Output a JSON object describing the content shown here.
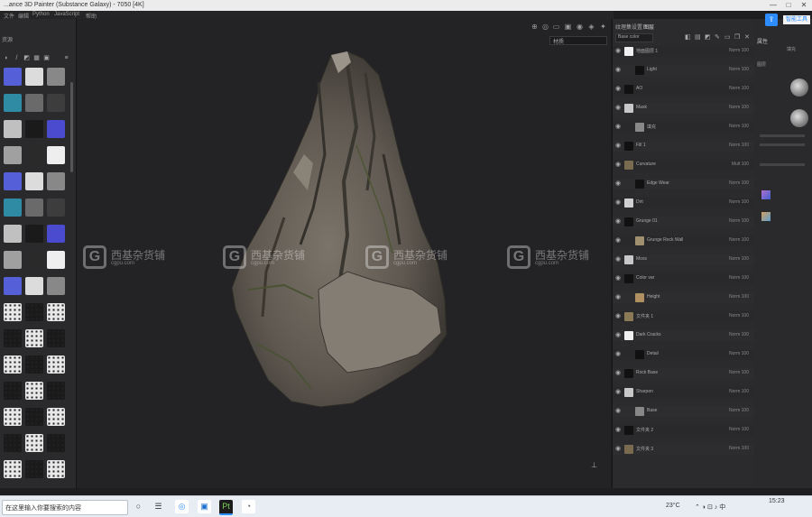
{
  "window": {
    "title": "...ance 3D Painter (Substance Galaxy) - 7050 [4K]",
    "controls": [
      "—",
      "□",
      "✕"
    ]
  },
  "menubar": {
    "items": [
      "文件",
      "编辑",
      "Python",
      "JavaScript",
      "帮助"
    ]
  },
  "left_shelf": {
    "header": "资源"
  },
  "viewport": {
    "dropdown_value": "材质"
  },
  "watermark": {
    "text": "西基杂货铺",
    "sub": "cgpu.com"
  },
  "layer_panel": {
    "tab_active": "图层",
    "tab_other": "纹理集设置",
    "blend_default": "Base color",
    "layers": [
      {
        "name": "地面图层 1",
        "blend": "Norm",
        "opacity": "100"
      },
      {
        "name": "Light",
        "blend": "Norm",
        "opacity": "100"
      },
      {
        "name": "AO",
        "blend": "Norm",
        "opacity": "100"
      },
      {
        "name": "Mask",
        "blend": "Norm",
        "opacity": "100"
      },
      {
        "name": "填充",
        "blend": "Norm",
        "opacity": "100"
      },
      {
        "name": "Fill 1",
        "blend": "Norm",
        "opacity": "100"
      },
      {
        "name": "Curvature",
        "blend": "Mult",
        "opacity": "100"
      },
      {
        "name": "Edge Wear",
        "blend": "Norm",
        "opacity": "100"
      },
      {
        "name": "Dirt",
        "blend": "Norm",
        "opacity": "100"
      },
      {
        "name": "Grunge 01",
        "blend": "Norm",
        "opacity": "100"
      },
      {
        "name": "Grunge Rock Wall",
        "blend": "Norm",
        "opacity": "100"
      },
      {
        "name": "Moss",
        "blend": "Norm",
        "opacity": "100"
      },
      {
        "name": "Color var",
        "blend": "Norm",
        "opacity": "100"
      },
      {
        "name": "Height",
        "blend": "Norm",
        "opacity": "100"
      },
      {
        "name": "文件夹 1",
        "blend": "Norm",
        "opacity": "100"
      },
      {
        "name": "Dark Cracks",
        "blend": "Norm",
        "opacity": "100"
      },
      {
        "name": "Detail",
        "blend": "Norm",
        "opacity": "100"
      },
      {
        "name": "Rock Base",
        "blend": "Norm",
        "opacity": "100"
      },
      {
        "name": "Sharpen",
        "blend": "Norm",
        "opacity": "100"
      },
      {
        "name": "Base",
        "blend": "Norm",
        "opacity": "100"
      },
      {
        "name": "文件夹 2",
        "blend": "Norm",
        "opacity": "100"
      },
      {
        "name": "文件夹 3",
        "blend": "Norm",
        "opacity": "100"
      }
    ]
  },
  "properties": {
    "header": "属性",
    "button": "智能工具",
    "labels": [
      "填充",
      "图层"
    ]
  },
  "taskbar": {
    "search_placeholder": "在这里输入你要搜索的内容",
    "time": "15:23",
    "temp": "23°C"
  },
  "colors": {
    "accent": "#2d8cff",
    "taskbar": "#e8edf4"
  }
}
